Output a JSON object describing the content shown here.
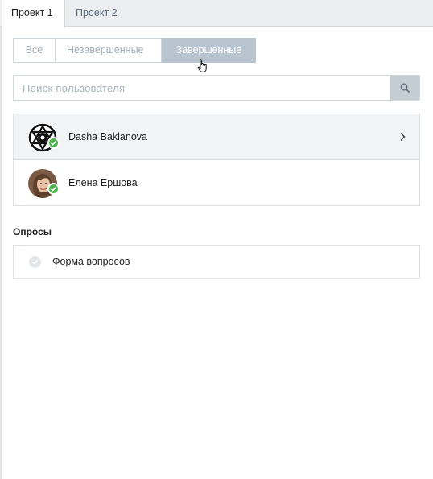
{
  "tabs": [
    {
      "label": "Проект 1",
      "active": true
    },
    {
      "label": "Проект 2",
      "active": false
    }
  ],
  "filter": {
    "options": [
      "Все",
      "Незавершенные",
      "Завершенные"
    ],
    "selected": "Завершенные"
  },
  "search": {
    "placeholder": "Поиск пользователя",
    "value": ""
  },
  "users": [
    {
      "name": "Dasha Baklanova",
      "status": "completed"
    },
    {
      "name": "Елена Ершова",
      "status": "completed"
    }
  ],
  "polls": {
    "title": "Опросы",
    "items": [
      {
        "label": "Форма вопросов"
      }
    ]
  },
  "colors": {
    "accent_check": "#4bb34b",
    "selected_segment": "#b8c4cf",
    "search_button": "#c4ccd4"
  },
  "icons": {
    "search": "search-icon",
    "check": "check-icon",
    "chevron": "chevron-right-icon",
    "cursor": "hand-pointer-icon"
  }
}
